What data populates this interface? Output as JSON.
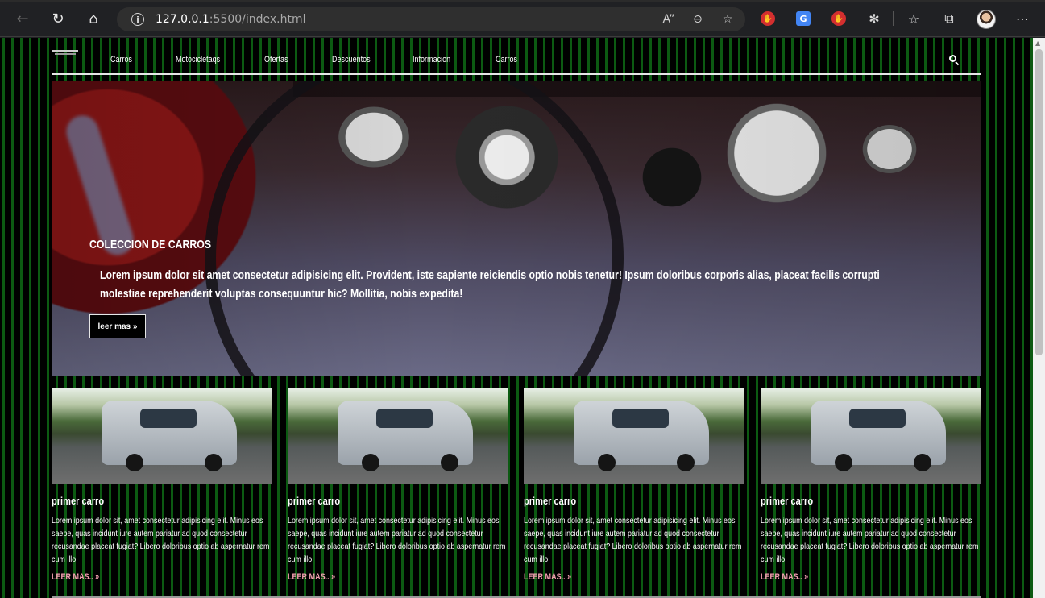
{
  "browser": {
    "url_host": "127.0.0.1",
    "url_rest": ":5500/index.html",
    "icons": [
      "back-icon",
      "reload-icon",
      "home-icon",
      "info-icon",
      "read-aloud-icon",
      "zoom-out-icon",
      "add-favorite-icon",
      "adblock-extension-icon",
      "translate-extension-icon",
      "adblock-extension-icon",
      "extensions-icon",
      "favorites-icon",
      "collections-icon",
      "profile-avatar",
      "more-icon"
    ]
  },
  "site": {
    "nav": {
      "links": [
        "Carros",
        "Motocicletaqs",
        "Ofertas",
        "Descuentos",
        "Informacion",
        "Carros"
      ]
    },
    "hero": {
      "title": "COLECCION DE CARROS",
      "text": "Lorem ipsum dolor sit amet consectetur adipisicing elit. Provident, iste sapiente reiciendis optio nobis tenetur! Ipsum doloribus corporis alias, placeat facilis corrupti molestiae reprehenderit voluptas consequuntur hic? Mollitia, nobis expedita!",
      "button_label": "leer mas »"
    },
    "cards": [
      {
        "title": "primer carro",
        "text": "Lorem ipsum dolor sit, amet consectetur adipisicing elit. Minus eos saepe, quas incidunt iure autem pariatur ad quod consectetur recusandae placeat fugiat? Libero doloribus optio ab aspernatur rem cum illo.",
        "link": "LEER MAS.. »"
      },
      {
        "title": "primer carro",
        "text": "Lorem ipsum dolor sit, amet consectetur adipisicing elit. Minus eos saepe, quas incidunt iure autem pariatur ad quod consectetur recusandae placeat fugiat? Libero doloribus optio ab aspernatur rem cum illo.",
        "link": "LEER MAS.. »"
      },
      {
        "title": "primer carro",
        "text": "Lorem ipsum dolor sit, amet consectetur adipisicing elit. Minus eos saepe, quas incidunt iure autem pariatur ad quod consectetur recusandae placeat fugiat? Libero doloribus optio ab aspernatur rem cum illo.",
        "link": "LEER MAS.. »"
      },
      {
        "title": "primer carro",
        "text": "Lorem ipsum dolor sit, amet consectetur adipisicing elit. Minus eos saepe, quas incidunt iure autem pariatur ad quod consectetur recusandae placeat fugiat? Libero doloribus optio ab aspernatur rem cum illo.",
        "link": "LEER MAS.. »"
      }
    ]
  },
  "colors": {
    "page_pattern": "#0c5a12",
    "link_pink": "#f3a0b0",
    "browser_bg": "#202124"
  }
}
